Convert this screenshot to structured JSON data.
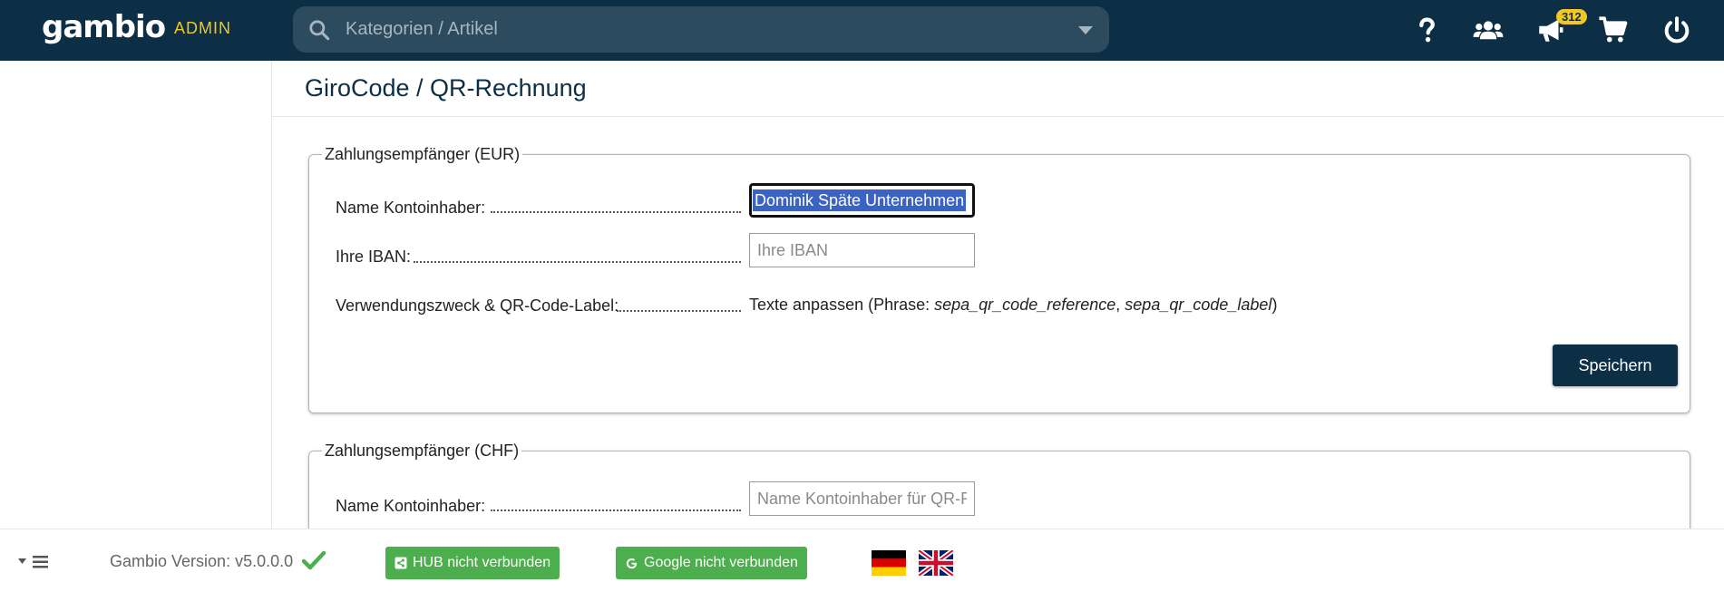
{
  "header": {
    "logo": "gambio",
    "admin_label": "ADMIN",
    "search_placeholder": "Kategorien / Artikel",
    "notification_count": "312",
    "icons": [
      "help-icon",
      "customers-icon",
      "megaphone-icon",
      "cart-icon",
      "power-icon"
    ]
  },
  "page": {
    "title": "GiroCode / QR-Rechnung"
  },
  "section_eur": {
    "legend": "Zahlungsempfänger (EUR)",
    "name_label": "Name Kontoinhaber:",
    "name_value": "Dominik Späte Unternehmen",
    "iban_label": "Ihre IBAN:",
    "iban_placeholder": "Ihre IBAN",
    "purpose_label": "Verwendungszweck & QR-Code-Label:",
    "purpose_text_prefix": "Texte anpassen (Phrase: ",
    "purpose_phrase1": "sepa_qr_code_reference",
    "purpose_sep": ", ",
    "purpose_phrase2": "sepa_qr_code_label",
    "purpose_text_suffix": ")",
    "save_label": "Speichern"
  },
  "section_chf": {
    "legend": "Zahlungsempfänger (CHF)",
    "name_label": "Name Kontoinhaber:",
    "name_placeholder": "Name Kontoinhaber für QR-Rechnung"
  },
  "footer": {
    "version": "Gambio Version: v5.0.0.0",
    "hub_label": "HUB nicht verbunden",
    "google_label": "Google nicht verbunden",
    "status_color": "#4cae4c"
  },
  "colors": {
    "topbar": "#0c2f45",
    "accent": "#f3c623"
  }
}
